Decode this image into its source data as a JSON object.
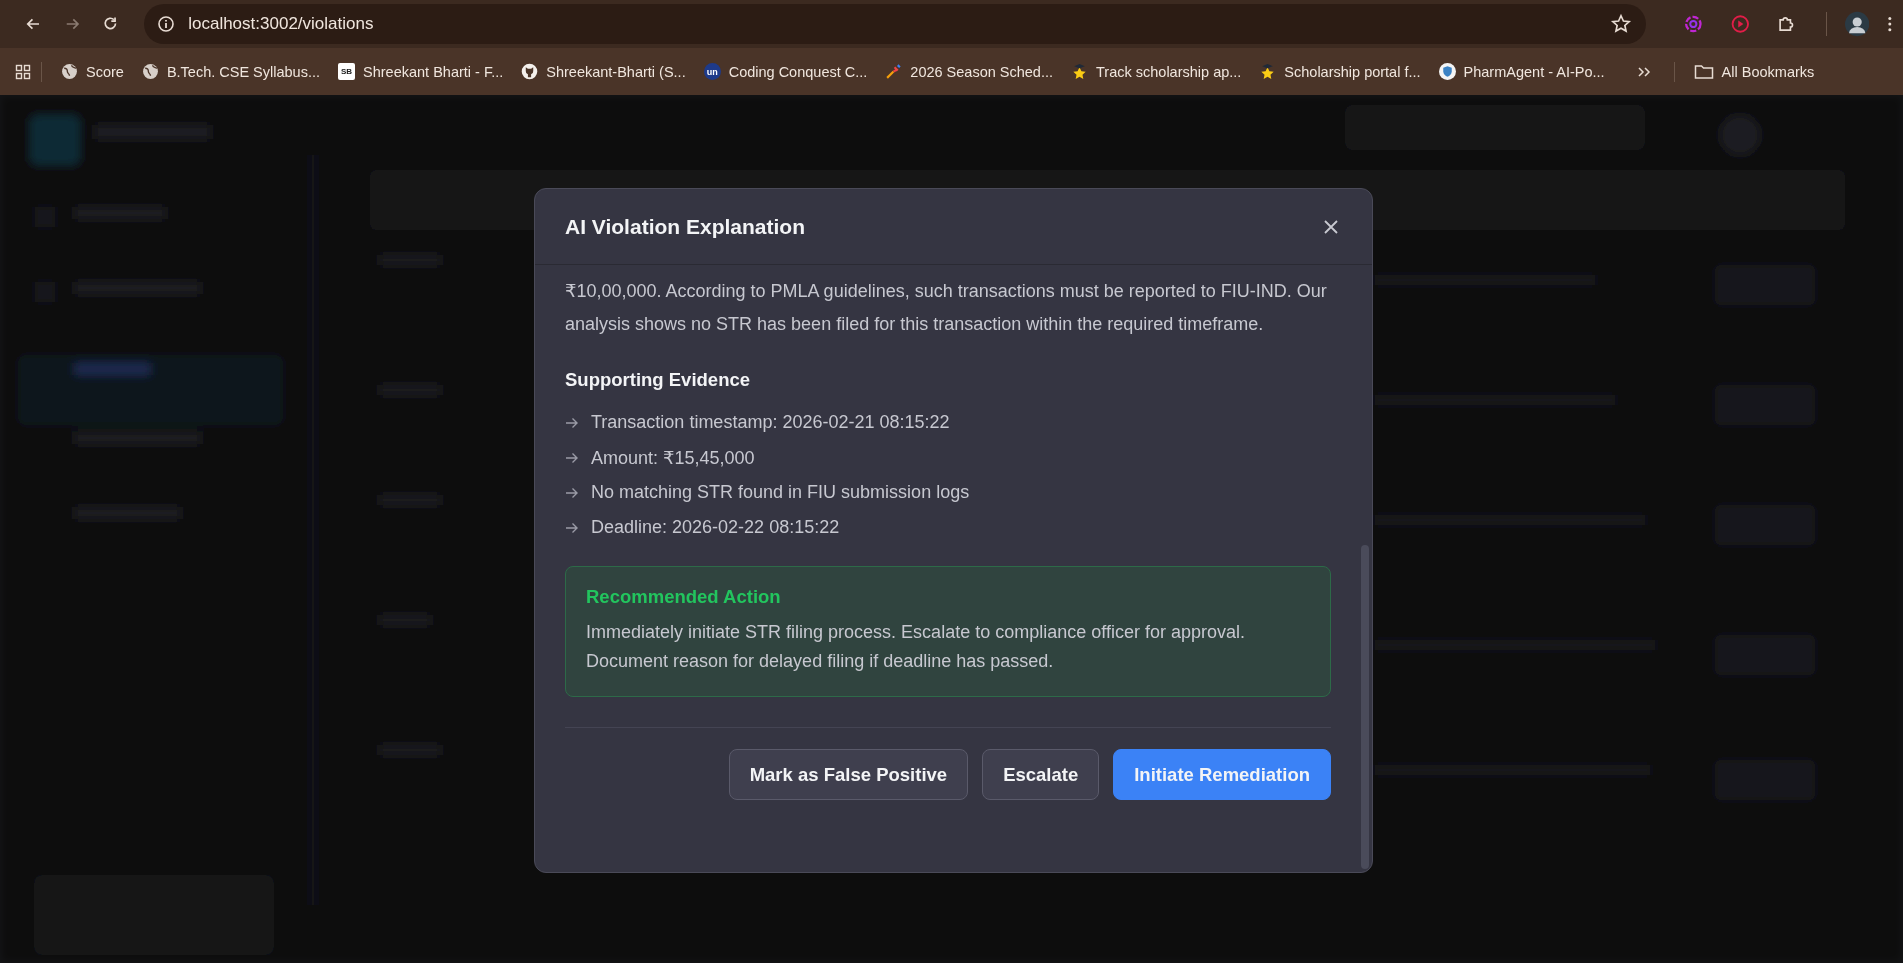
{
  "browser": {
    "url": "localhost:3002/violations",
    "bookmarks": [
      {
        "title": "Score",
        "kind": "globe"
      },
      {
        "title": "B.Tech. CSE Syllabus...",
        "kind": "globe"
      },
      {
        "title": "Shreekant Bharti - F...",
        "kind": "badge",
        "badge": "SB"
      },
      {
        "title": "Shreekant-Bharti (S...",
        "kind": "github"
      },
      {
        "title": "Coding Conquest C...",
        "kind": "circle",
        "badge": "un"
      },
      {
        "title": "2026 Season Sched...",
        "kind": "sports"
      },
      {
        "title": "Track scholarship ap...",
        "kind": "scholar"
      },
      {
        "title": "Scholarship portal f...",
        "kind": "scholar"
      },
      {
        "title": "PharmAgent - AI-Po...",
        "kind": "shield"
      }
    ],
    "all_bookmarks": "All Bookmarks"
  },
  "modal": {
    "title": "AI Violation Explanation",
    "explanation": "₹10,00,000. According to PMLA guidelines, such transactions must be reported to FIU-IND. Our analysis shows no STR has been filed for this transaction within the required timeframe.",
    "evidence_heading": "Supporting Evidence",
    "evidence": [
      "Transaction timestamp: 2026-02-21 08:15:22",
      "Amount: ₹15,45,000",
      "No matching STR found in FIU submission logs",
      "Deadline: 2026-02-22 08:15:22"
    ],
    "recommendation": {
      "title": "Recommended Action",
      "text": "Immediately initiate STR filing process. Escalate to compliance officer for approval. Document reason for delayed filing if deadline has passed."
    },
    "buttons": [
      {
        "label": "Mark as False Positive",
        "kind": "secondary"
      },
      {
        "label": "Escalate",
        "kind": "secondary"
      },
      {
        "label": "Initiate Remediation",
        "kind": "primary"
      }
    ]
  }
}
